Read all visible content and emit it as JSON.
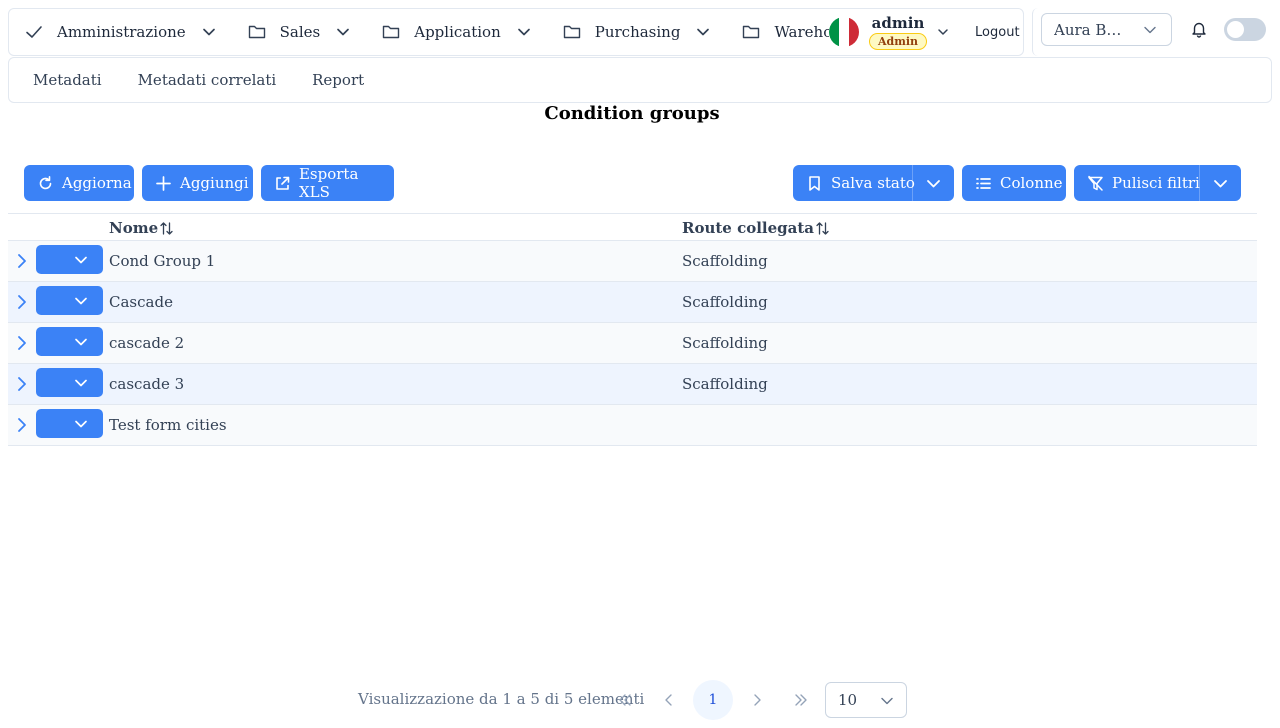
{
  "nav": {
    "items": [
      {
        "label": "Amministrazione",
        "icon": "check-icon"
      },
      {
        "label": "Sales",
        "icon": "folder-icon"
      },
      {
        "label": "Application",
        "icon": "folder-icon"
      },
      {
        "label": "Purchasing",
        "icon": "folder-icon"
      },
      {
        "label": "Warehou",
        "icon": "folder-icon"
      }
    ],
    "user": {
      "name": "admin",
      "role": "Admin",
      "flag_colors": [
        "#009246",
        "#ffffff",
        "#ce2b37"
      ]
    },
    "logout_label": "Logout",
    "company_select": {
      "value": "Aura B…"
    }
  },
  "tabs": [
    {
      "label": "Metadati"
    },
    {
      "label": "Metadati correlati"
    },
    {
      "label": "Report"
    }
  ],
  "page": {
    "title": "Condition groups"
  },
  "toolbar": {
    "refresh_label": "Aggiorna",
    "add_label": "Aggiungi",
    "export_label": "Esporta XLS",
    "save_state_label": "Salva stato",
    "columns_label": "Colonne",
    "clear_filters_label": "Pulisci filtri"
  },
  "table": {
    "columns": [
      {
        "label": "Nome"
      },
      {
        "label": "Route collegata"
      }
    ],
    "rows": [
      {
        "name": "Cond Group 1",
        "route": "Scaffolding"
      },
      {
        "name": "Cascade",
        "route": "Scaffolding"
      },
      {
        "name": "cascade 2",
        "route": "Scaffolding"
      },
      {
        "name": "cascade 3",
        "route": "Scaffolding"
      },
      {
        "name": "Test form cities",
        "route": ""
      }
    ]
  },
  "pagination": {
    "summary": "Visualizzazione da 1 a 5 di 5 elementi",
    "current_page": "1",
    "rows_per_page": "10"
  },
  "colors": {
    "primary": "#3b82f6",
    "row_alt": "#eef4fe"
  }
}
